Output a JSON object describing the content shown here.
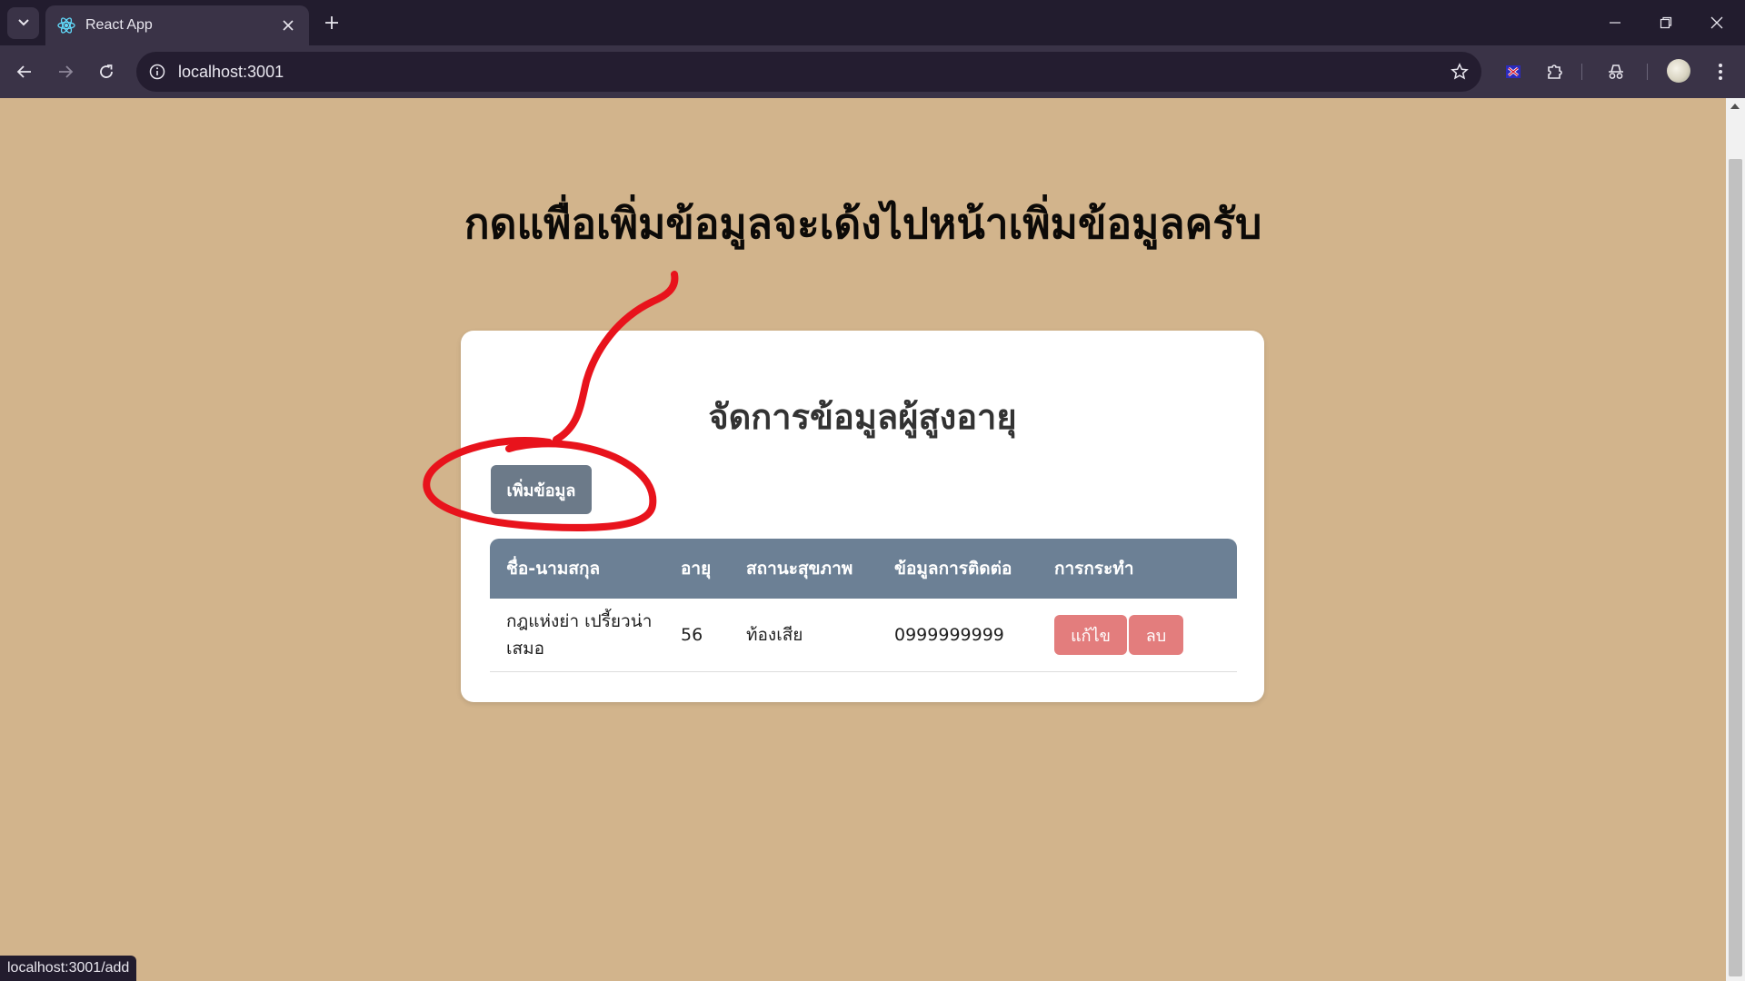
{
  "browser": {
    "tab_title": "React App",
    "url": "localhost:3001",
    "status_link": "localhost:3001/add"
  },
  "page": {
    "heading": "กดแพื่อเพิ่มข้อมูลจะเด้งไปหน้าเพิ่มข้อมูลครับ",
    "card_title": "จัดการข้อมูลผู้สูงอายุ",
    "add_button_label": "เพิ่มข้อมูล",
    "table": {
      "headers": [
        "ชื่อ-นามสกุล",
        "อายุ",
        "สถานะสุขภาพ",
        "ข้อมูลการติดต่อ",
        "การกระทำ"
      ],
      "rows": [
        {
          "name": "กฎแห่งย่า เปรี้ยวน่าเสมอ",
          "age": "56",
          "health": "ท้องเสีย",
          "contact": "0999999999",
          "edit_label": "แก้ไข",
          "delete_label": "ลบ"
        }
      ]
    }
  },
  "colors": {
    "page_background": "#d2b48c",
    "card_background": "#ffffff",
    "header_background": "#6c8095",
    "add_button": "#6c7a89",
    "action_button": "#e37d7d",
    "annotation_stroke": "#e8131c"
  },
  "icons": [
    "tab-search-icon",
    "react-favicon-icon",
    "close-icon",
    "plus-icon",
    "minimize-icon",
    "restore-icon",
    "window-close-icon",
    "back-arrow-icon",
    "forward-arrow-icon",
    "reload-icon",
    "info-icon",
    "star-icon",
    "extension-flag-icon",
    "puzzle-icon",
    "incognito-icon",
    "menu-dots-icon"
  ]
}
